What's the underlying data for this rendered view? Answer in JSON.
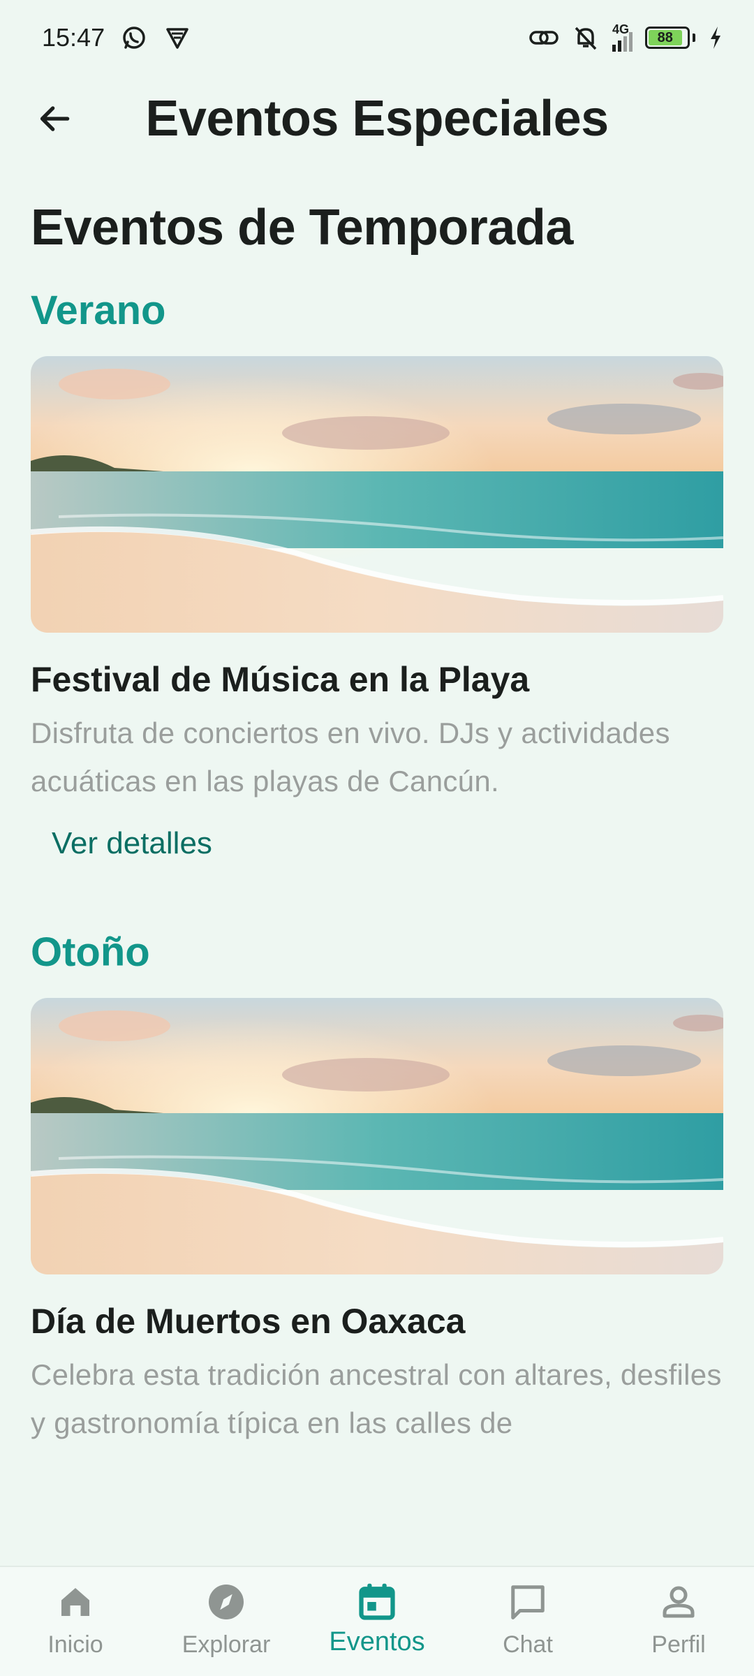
{
  "status_bar": {
    "time": "15:47",
    "network": "4G",
    "battery": "88",
    "left_icons": [
      "whatsapp-icon",
      "vpn-shield-icon"
    ],
    "right_icons": [
      "link-icon",
      "bell-off-icon",
      "signal-icon",
      "battery-icon",
      "charging-icon"
    ]
  },
  "app_bar": {
    "title": "Eventos Especiales",
    "back_icon": "arrow-back-icon"
  },
  "main": {
    "heading": "Eventos de Temporada",
    "sections": [
      {
        "season": "Verano",
        "event_title": "Festival de Música en la Playa",
        "event_description": "Disfruta de conciertos en vivo. DJs y actividades acuáticas en las playas de Cancún.",
        "details_label": "Ver detalles"
      },
      {
        "season": "Otoño",
        "event_title": "Día de Muertos en Oaxaca",
        "event_description": "Celebra esta tradición ancestral con altares, desfiles y gastronomía típica en las calles de"
      }
    ]
  },
  "bottom_nav": {
    "items": [
      {
        "label": "Inicio",
        "icon": "home-icon",
        "active": false
      },
      {
        "label": "Explorar",
        "icon": "compass-icon",
        "active": false
      },
      {
        "label": "Eventos",
        "icon": "calendar-icon",
        "active": true
      },
      {
        "label": "Chat",
        "icon": "chat-icon",
        "active": false
      },
      {
        "label": "Perfil",
        "icon": "person-icon",
        "active": false
      }
    ]
  },
  "colors": {
    "background": "#eef7f2",
    "accent": "#12968a",
    "link": "#0b6e63",
    "muted_text": "#9a9e9c"
  }
}
